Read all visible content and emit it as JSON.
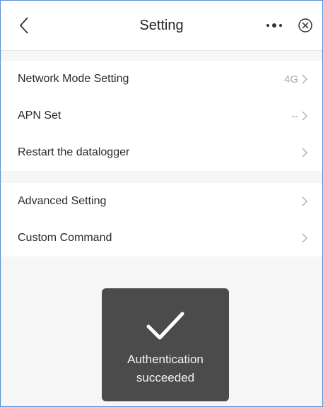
{
  "header": {
    "title": "Setting",
    "back_icon": "chevron-left-icon",
    "more_icon": "more-dots-icon",
    "close_icon": "close-circle-icon"
  },
  "groups": [
    {
      "rows": [
        {
          "label": "Network Mode Setting",
          "value": "4G"
        },
        {
          "label": "APN Set",
          "value": "--"
        },
        {
          "label": "Restart the datalogger",
          "value": ""
        }
      ]
    },
    {
      "rows": [
        {
          "label": "Advanced Setting",
          "value": ""
        },
        {
          "label": "Custom Command",
          "value": ""
        }
      ]
    }
  ],
  "toast": {
    "icon": "checkmark-icon",
    "line1": "Authentication",
    "line2": "succeeded"
  },
  "colors": {
    "background": "#f6f6f6",
    "toast_bg": "#4b4b4b",
    "value_text": "#a8a8a8"
  }
}
